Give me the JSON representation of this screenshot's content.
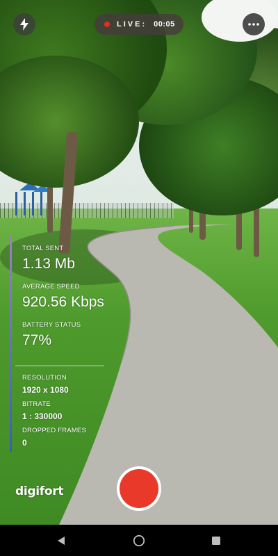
{
  "top_bar": {
    "flash_icon": "lightning-icon",
    "live_label": "LIVE:",
    "timer": "00:05",
    "more_icon": "more-horizontal-icon"
  },
  "stats": {
    "total_sent_label": "TOTAL SENT",
    "total_sent_value": "1.13 Mb",
    "average_speed_label": "AVERAGE SPEED",
    "average_speed_value": "920.56 Kbps",
    "battery_status_label": "BATTERY STATUS",
    "battery_status_value": "77%",
    "resolution_label": "RESOLUTION",
    "resolution_value": "1920 x 1080",
    "bitrate_label": "BITRATE",
    "bitrate_value": "1 : 330000",
    "dropped_frames_label": "DROPPED FRAMES",
    "dropped_frames_value": "0"
  },
  "brand": {
    "logo_text": "digifort"
  },
  "colors": {
    "record": "#e8392a",
    "live_dot": "#e0301e",
    "stats_bar_top": "#9b7fc4",
    "stats_bar_bottom": "#3a5fb2"
  },
  "nav": {
    "back_icon": "back-triangle-icon",
    "home_icon": "home-circle-icon",
    "recents_icon": "recents-square-icon"
  }
}
